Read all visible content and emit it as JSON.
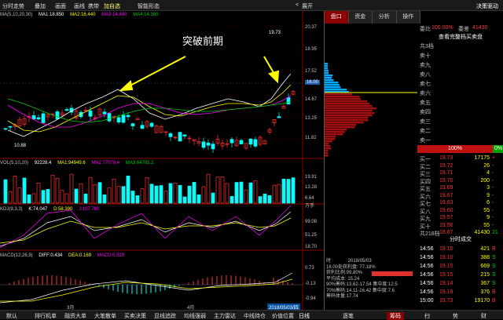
{
  "toolbar": {
    "items": [
      "分时走势",
      "叠加",
      "画面",
      "画线",
      "携带",
      "加自选",
      "智能形态"
    ],
    "right": [
      "<",
      "展开"
    ],
    "decision": "决策驱动"
  },
  "main": {
    "ma_header": [
      "MA(5,10,20,30)",
      "MA1:18.850",
      "MA2:16.440",
      "MA3:14.490",
      "MA4:14.160"
    ],
    "annotation": "突破前期",
    "high_label": "19.73",
    "low_label": "10.88",
    "price_axis": [
      "20.37",
      "18.95",
      "17.52",
      "16.00",
      "14.67",
      "13.25",
      "11.82"
    ],
    "current_price": "16.00"
  },
  "vol": {
    "header": [
      "VOL(5,10,20)",
      "92228.4",
      "MA1:94949.6",
      "MA2:77070.4",
      "MA3:64705.2"
    ],
    "axis": [
      "19.91",
      "13.28",
      "6.64",
      "万手"
    ]
  },
  "kdj": {
    "header": [
      "KDJ(9,3,3)",
      "K:74.047",
      "D:58.390",
      "J:107.760"
    ],
    "axis": [
      "99.08",
      "51.25",
      "18.70"
    ]
  },
  "macd": {
    "header": [
      "MACD(12,26,9)",
      "DIFF:0.434",
      "DEA:0.169",
      "MACD:0.529"
    ],
    "axis": [
      "0.73",
      "-0.13",
      "-0.94"
    ],
    "months": [
      "3月",
      "4月"
    ],
    "date_box": "2018/05/03/四"
  },
  "info_box": {
    "time_label": "时",
    "date": "2018/05/03",
    "lines": [
      "16.00处获利盘: 77.18%",
      "获利比例:99.80%",
      "平均成本: 15.24",
      "90%筹码:13.62-17.54 集中度:12.5",
      "70%筹码:14.11-16.42 集中度:7.6",
      "筹码体量:17.74"
    ]
  },
  "right": {
    "tabs": [
      "盘口",
      "资金",
      "分析",
      "操作"
    ],
    "wb_label": "委比",
    "wb_value": "100.00%",
    "wc_label": "委差",
    "wc_value": "41430",
    "view_label": "查看完整档买卖盘",
    "sell_levels": [
      "共3档",
      "卖十",
      "卖九",
      "卖八",
      "卖七",
      "卖六",
      "卖五",
      "卖四",
      "卖三",
      "卖二",
      "卖一"
    ],
    "ratio_left": "100%",
    "ratio_right": "0%",
    "buy_levels": [
      {
        "name": "买一",
        "price": "19.73",
        "vol": "17175",
        "sign": "+"
      },
      {
        "name": "买二",
        "price": "19.72",
        "vol": "26",
        "sign": "-"
      },
      {
        "name": "买三",
        "price": "19.71",
        "vol": "4",
        "sign": "-"
      },
      {
        "name": "买四",
        "price": "19.70",
        "vol": "200",
        "sign": "-"
      },
      {
        "name": "买五",
        "price": "19.69",
        "vol": "3",
        "sign": "-"
      },
      {
        "name": "买六",
        "price": "19.67",
        "vol": "9",
        "sign": "-"
      },
      {
        "name": "买七",
        "price": "19.63",
        "vol": "6",
        "sign": "-"
      },
      {
        "name": "买八",
        "price": "19.60",
        "vol": "55",
        "sign": "-"
      },
      {
        "name": "买九",
        "price": "19.57",
        "vol": "9",
        "sign": "-"
      },
      {
        "name": "买十",
        "price": "19.56",
        "vol": "55",
        "sign": "-"
      },
      {
        "name": "共218档",
        "price": "18.67",
        "vol": "41430",
        "sign": "21"
      }
    ],
    "trades_title": "分时成交",
    "trades": [
      {
        "time": "14:56",
        "price": "19.10",
        "vol": "421",
        "flag": "B"
      },
      {
        "time": "14:56",
        "price": "19.10",
        "vol": "388",
        "flag": "S"
      },
      {
        "time": "14:56",
        "price": "19.15",
        "vol": "669",
        "flag": "S"
      },
      {
        "time": "14:56",
        "price": "19.15",
        "vol": "215",
        "flag": "S"
      },
      {
        "time": "14:56",
        "price": "19.14",
        "vol": "367",
        "flag": "S"
      },
      {
        "time": "14:56",
        "price": "19.19",
        "vol": "376",
        "flag": "B"
      },
      {
        "time": "15:00",
        "price": "19.73",
        "vol": "19170",
        "flag": "B"
      }
    ]
  },
  "bottom": {
    "left": [
      "默认",
      "排行机单",
      "融资大单",
      "大笔散单",
      "买卖决策",
      "显线追踪",
      "均线强弱",
      "主力雷达",
      "中线持仓",
      "价值位置",
      "日线"
    ],
    "right": [
      "逐笔",
      "筹码",
      "扫",
      "势",
      "财"
    ]
  }
}
